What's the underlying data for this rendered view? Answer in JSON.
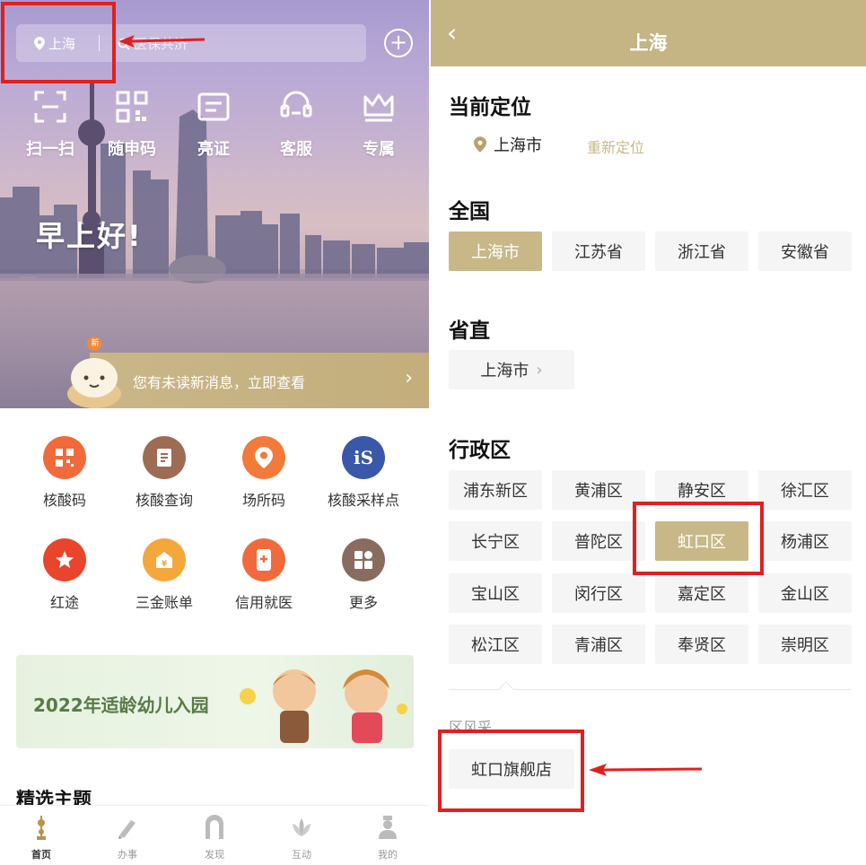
{
  "left": {
    "location": {
      "city": "上海",
      "search_placeholder": "医保共济"
    },
    "quick_actions": [
      {
        "label": "扫一扫",
        "icon": "scan-icon"
      },
      {
        "label": "随申码",
        "icon": "qr-code-icon"
      },
      {
        "label": "亮证",
        "icon": "id-card-icon"
      },
      {
        "label": "客服",
        "icon": "headset-icon"
      },
      {
        "label": "专属",
        "icon": "crown-icon"
      }
    ],
    "greeting": "早上好!",
    "message_badge": "新",
    "message_text": "您有未读新消息，立即查看",
    "services": [
      {
        "label": "核酸码",
        "color": "#f06a3c",
        "icon": "qr-code-icon"
      },
      {
        "label": "核酸查询",
        "color": "#9e6b54",
        "icon": "document-icon"
      },
      {
        "label": "场所码",
        "color": "#f27a3a",
        "icon": "location-icon"
      },
      {
        "label": "核酸采样点",
        "color": "#3a58a8",
        "icon": "is-logo-icon"
      },
      {
        "label": "红途",
        "color": "#e8452c",
        "icon": "star-icon"
      },
      {
        "label": "三金账单",
        "color": "#f4a73a",
        "icon": "wallet-icon"
      },
      {
        "label": "信用就医",
        "color": "#f06a3c",
        "icon": "phone-plus-icon"
      },
      {
        "label": "更多",
        "color": "#8a6b60",
        "icon": "grid-icon"
      }
    ],
    "banner_text": "2022年适龄幼儿入园",
    "section_title": "精选主题",
    "tabs": [
      {
        "label": "首页",
        "icon": "home-tower-icon"
      },
      {
        "label": "办事",
        "icon": "pen-icon"
      },
      {
        "label": "发现",
        "icon": "arch-icon"
      },
      {
        "label": "互动",
        "icon": "magnolia-icon"
      },
      {
        "label": "我的",
        "icon": "person-icon"
      }
    ]
  },
  "right": {
    "title": "上海",
    "current_location_heading": "当前定位",
    "current_city": "上海市",
    "relocate_label": "重新定位",
    "national_heading": "全国",
    "national": [
      "上海市",
      "江苏省",
      "浙江省",
      "安徽省"
    ],
    "provincial_heading": "省直",
    "provincial": "上海市",
    "district_heading": "行政区",
    "districts": [
      "浦东新区",
      "黄浦区",
      "静安区",
      "徐汇区",
      "长宁区",
      "普陀区",
      "虹口区",
      "杨浦区",
      "宝山区",
      "闵行区",
      "嘉定区",
      "金山区",
      "松江区",
      "青浦区",
      "奉贤区",
      "崇明区"
    ],
    "selected_district": "虹口区",
    "district_style_heading": "区风采",
    "flagship_store": "虹口旗舰店"
  },
  "colors": {
    "gold": "#c5b585",
    "annotation_red": "#e02020"
  }
}
